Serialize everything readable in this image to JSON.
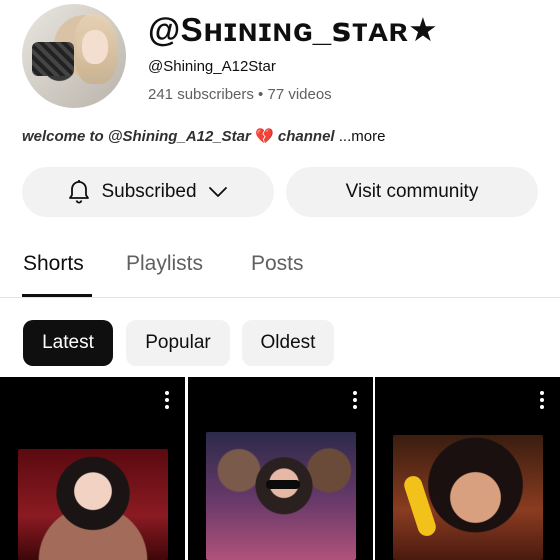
{
  "channel": {
    "name": "@Sʜɪɴɪɴɢ_ꜱᴛᴀʀ★",
    "handle": "@Shining_A12Star",
    "stats": "241 subscribers • 77 videos",
    "description": "welcome to @Shining_A12_Star",
    "description_emoji": "💔",
    "description_tail": " channel",
    "more_label": "...more"
  },
  "actions": {
    "subscribed_label": "Subscribed",
    "visit_label": "Visit community",
    "bell_icon": "bell-icon",
    "chevron_icon": "chevron-down-icon"
  },
  "tabs": [
    {
      "label": "Shorts",
      "active": true
    },
    {
      "label": "Playlists",
      "active": false
    },
    {
      "label": "Posts",
      "active": false
    }
  ],
  "filters": [
    {
      "label": "Latest",
      "active": true
    },
    {
      "label": "Popular",
      "active": false
    },
    {
      "label": "Oldest",
      "active": false
    }
  ],
  "shorts": [
    {
      "menu_icon": "more-vert-icon"
    },
    {
      "menu_icon": "more-vert-icon"
    },
    {
      "menu_icon": "more-vert-icon"
    }
  ],
  "colors": {
    "active_chip_bg": "#0f0f0f",
    "pill_bg": "#f2f2f2",
    "secondary_text": "#606060"
  }
}
